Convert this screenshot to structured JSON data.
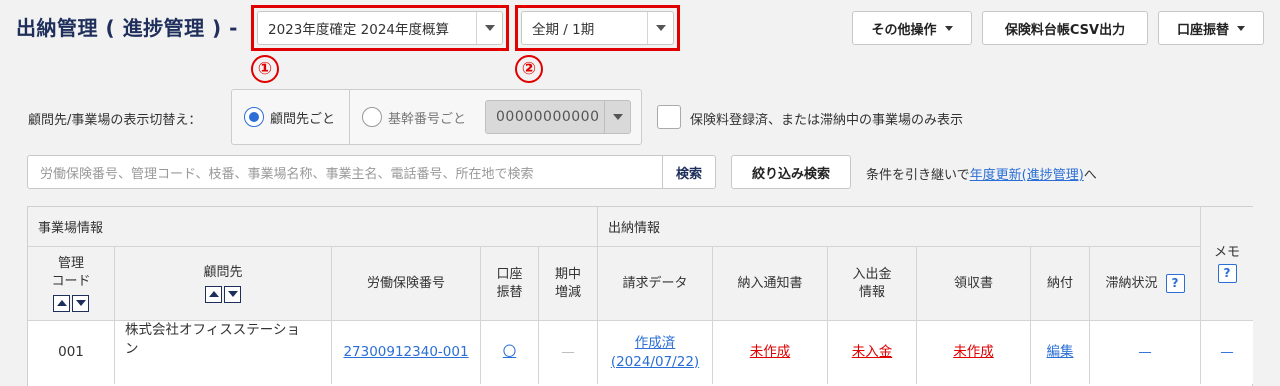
{
  "header": {
    "title": "出納管理 ( 進捗管理 ) -",
    "year_select": "2023年度確定 2024年度概算",
    "period_select": "全期 / 1期",
    "marker_1": "①",
    "marker_2": "②",
    "other_ops_label": "その他操作",
    "csv_label": "保険料台帳CSV出力",
    "transfer_label": "口座振替"
  },
  "filter": {
    "view_toggle_label": "顧問先/事業場の表示切替え：",
    "radio_client": "顧問先ごと",
    "radio_base": "基幹番号ごと",
    "base_code_value": "00000000000",
    "checkbox_label": "保険料登録済、または滞納中の事業場のみ表示",
    "search_placeholder": "労働保険番号、管理コード、枝番、事業場名称、事業主名、電話番号、所在地で検索",
    "search_button": "検索",
    "refine_button": "絞り込み検索",
    "carry_text_prefix": "条件を引き継いで",
    "carry_link": "年度更新(進捗管理)",
    "carry_text_suffix": "へ"
  },
  "table": {
    "group_business": "事業場情報",
    "group_cash": "出納情報",
    "col_code_1": "管理",
    "col_code_2": "コード",
    "col_client": "顧問先",
    "col_insurance_no": "労働保険番号",
    "col_transfer_1": "口座",
    "col_transfer_2": "振替",
    "col_change_1": "期中",
    "col_change_2": "増減",
    "col_billing": "請求データ",
    "col_notice": "納入通知書",
    "col_inout_1": "入出金",
    "col_inout_2": "情報",
    "col_receipt": "領収書",
    "col_payment": "納付",
    "col_arrears": "滞納状況",
    "col_memo": "メモ",
    "help_glyph": "?",
    "rows": [
      {
        "code": "001",
        "client_1": "株式会社オフィスステーショ",
        "client_2": "ン",
        "insurance_no": "27300912340-001",
        "transfer": "〇",
        "change": "—",
        "billing_1": "作成済",
        "billing_2": "(2024/07/22)",
        "notice": "未作成",
        "inout": "未入金",
        "receipt": "未作成",
        "payment": "編集",
        "arrears": "—",
        "memo": "—"
      }
    ]
  },
  "colors": {
    "accent": "#1f2f5c",
    "link": "#2b6fd6",
    "alert": "#e00000"
  }
}
